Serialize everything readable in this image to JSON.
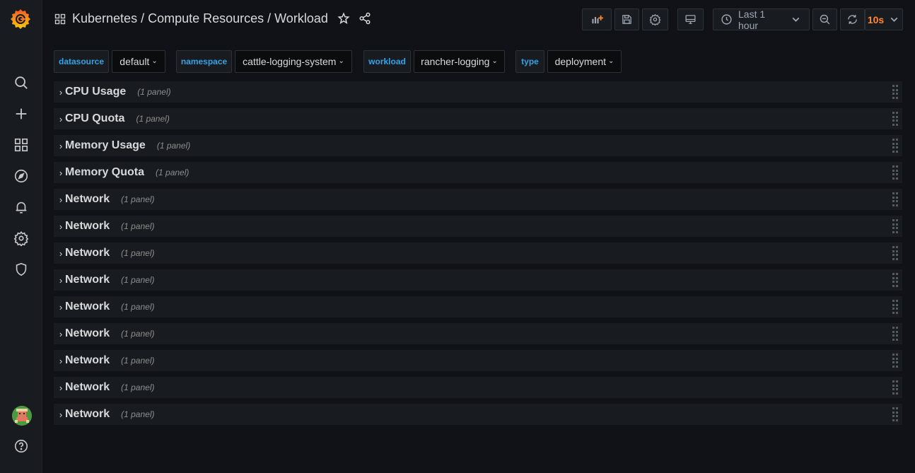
{
  "sidebar": {
    "logo": "grafana-logo",
    "items": [
      {
        "name": "search-icon"
      },
      {
        "name": "plus-icon"
      },
      {
        "name": "dashboards-icon"
      },
      {
        "name": "explore-compass-icon"
      },
      {
        "name": "alerting-bell-icon"
      },
      {
        "name": "configuration-gear-icon"
      },
      {
        "name": "server-admin-shield-icon"
      }
    ],
    "bottom": [
      {
        "name": "avatar"
      },
      {
        "name": "help-icon"
      }
    ]
  },
  "header": {
    "breadcrumb": "Kubernetes / Compute Resources / Workload"
  },
  "toolbar": {
    "time_range": "Last 1 hour",
    "refresh_interval": "10s"
  },
  "variables": [
    {
      "label": "datasource",
      "value": "default"
    },
    {
      "label": "namespace",
      "value": "cattle-logging-system"
    },
    {
      "label": "workload",
      "value": "rancher-logging"
    },
    {
      "label": "type",
      "value": "deployment"
    }
  ],
  "rows": [
    {
      "title": "CPU Usage",
      "count": "(1 panel)"
    },
    {
      "title": "CPU Quota",
      "count": "(1 panel)"
    },
    {
      "title": "Memory Usage",
      "count": "(1 panel)"
    },
    {
      "title": "Memory Quota",
      "count": "(1 panel)"
    },
    {
      "title": "Network",
      "count": "(1 panel)"
    },
    {
      "title": "Network",
      "count": "(1 panel)"
    },
    {
      "title": "Network",
      "count": "(1 panel)"
    },
    {
      "title": "Network",
      "count": "(1 panel)"
    },
    {
      "title": "Network",
      "count": "(1 panel)"
    },
    {
      "title": "Network",
      "count": "(1 panel)"
    },
    {
      "title": "Network",
      "count": "(1 panel)"
    },
    {
      "title": "Network",
      "count": "(1 panel)"
    },
    {
      "title": "Network",
      "count": "(1 panel)"
    }
  ],
  "colors": {
    "background": "#111217",
    "panel": "#181b1f",
    "variable_label": "#33a2e5",
    "refresh_accent": "#ff8833",
    "logo_orange": "#f46800"
  }
}
